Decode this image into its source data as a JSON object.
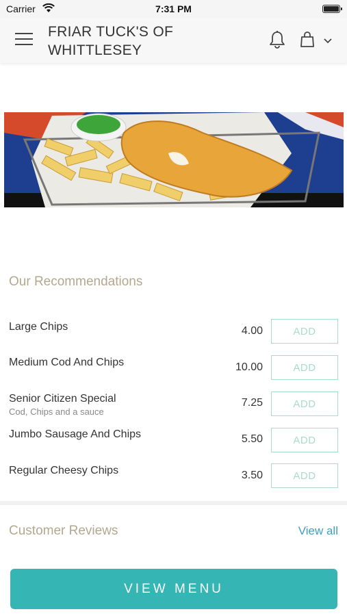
{
  "status_bar": {
    "carrier": "Carrier",
    "time": "7:31 PM"
  },
  "header": {
    "title": "FRIAR TUCK'S OF WHITTLESEY",
    "icons": [
      "menu-icon",
      "bell-icon",
      "shopping-bag-icon",
      "chevron-down-icon"
    ]
  },
  "hero": {
    "image": "fish-and-chips-basket"
  },
  "recommendations": {
    "title": "Our Recommendations",
    "add_label": "ADD",
    "items": [
      {
        "name": "Large Chips",
        "description": "",
        "price": "4.00"
      },
      {
        "name": "Medium Cod And Chips",
        "description": "",
        "price": "10.00"
      },
      {
        "name": "Senior Citizen Special",
        "description": "Cod, Chips and a sauce",
        "price": "7.25"
      },
      {
        "name": "Jumbo Sausage And Chips",
        "description": "",
        "price": "5.50"
      },
      {
        "name": "Regular Cheesy Chips",
        "description": "",
        "price": "3.50"
      }
    ]
  },
  "reviews": {
    "title": "Customer Reviews",
    "view_all_label": "View all"
  },
  "footer": {
    "view_menu_label": "VIEW MENU"
  },
  "colors": {
    "accent_teal": "#35b5b4",
    "section_title": "#b3a88e",
    "add_border": "#a9dcc8",
    "link_blue": "#3f9fc4"
  }
}
